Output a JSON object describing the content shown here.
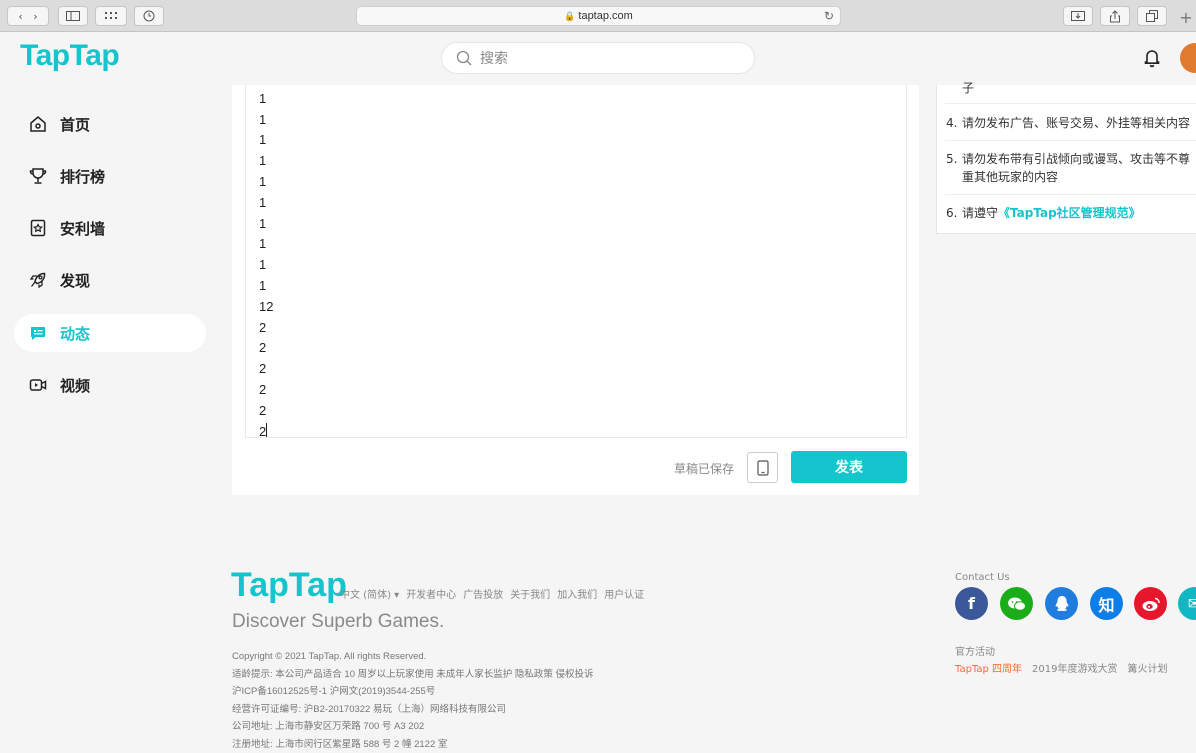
{
  "browser": {
    "url": "taptap.com"
  },
  "header": {
    "logo": "TapTap",
    "search_placeholder": "搜索"
  },
  "sidebar": {
    "items": [
      {
        "label": "首页"
      },
      {
        "label": "排行榜"
      },
      {
        "label": "安利墙"
      },
      {
        "label": "发现"
      },
      {
        "label": "动态"
      },
      {
        "label": "视频"
      }
    ]
  },
  "editor": {
    "lines": [
      "1",
      "1",
      "1",
      "1",
      "1",
      "1",
      "1",
      "1",
      "1",
      "1",
      "12",
      "2",
      "2",
      "2",
      "2",
      "2",
      "2"
    ],
    "draft_status": "草稿已保存",
    "publish_label": "发表"
  },
  "rules": {
    "item3_tail": "子",
    "items": [
      {
        "num": "4.",
        "text": "请勿发布广告、账号交易、外挂等相关内容"
      },
      {
        "num": "5.",
        "text": "请勿发布带有引战倾向或谩骂、攻击等不尊重其他玩家的内容"
      },
      {
        "num": "6.",
        "text": "请遵守",
        "link": "《TapTap社区管理规范》"
      }
    ]
  },
  "footer": {
    "logo": "TapTap",
    "links": [
      "中文 (简体) ▾",
      "开发者中心",
      "广告投放",
      "关于我们",
      "加入我们",
      "用户认证"
    ],
    "tagline": "Discover Superb Games.",
    "legal": [
      "Copyright © 2021 TapTap. All rights Reserved.",
      "适龄提示: 本公司产品适合 10 周岁以上玩家使用  未成年人家长监护  隐私政策  侵权投诉",
      "沪ICP备16012525号-1   沪网文(2019)3544-255号",
      "经营许可证编号: 沪B2-20170322   易玩（上海）网络科技有限公司",
      "公司地址: 上海市静安区万荣路 700 号 A3 202",
      "注册地址: 上海市闵行区紫星路 588 号 2 幢 2122 室"
    ],
    "contact_label": "Contact Us",
    "social": [
      {
        "name": "facebook",
        "glyph": "f",
        "color": "#3b5998"
      },
      {
        "name": "wechat",
        "glyph": "",
        "color": "#1aad19"
      },
      {
        "name": "qq",
        "glyph": "",
        "color": "#1f7de0"
      },
      {
        "name": "zhihu",
        "glyph": "知",
        "color": "#0d7ee8"
      },
      {
        "name": "weibo",
        "glyph": "",
        "color": "#e6162d"
      },
      {
        "name": "email",
        "glyph": "✉",
        "color": "#12b7c4"
      }
    ],
    "activity_label": "官方活动",
    "activities": [
      "TapTap 四周年",
      "2019年度游戏大赏",
      "篝火计划"
    ]
  },
  "colors": {
    "accent": "#14c5cd"
  }
}
